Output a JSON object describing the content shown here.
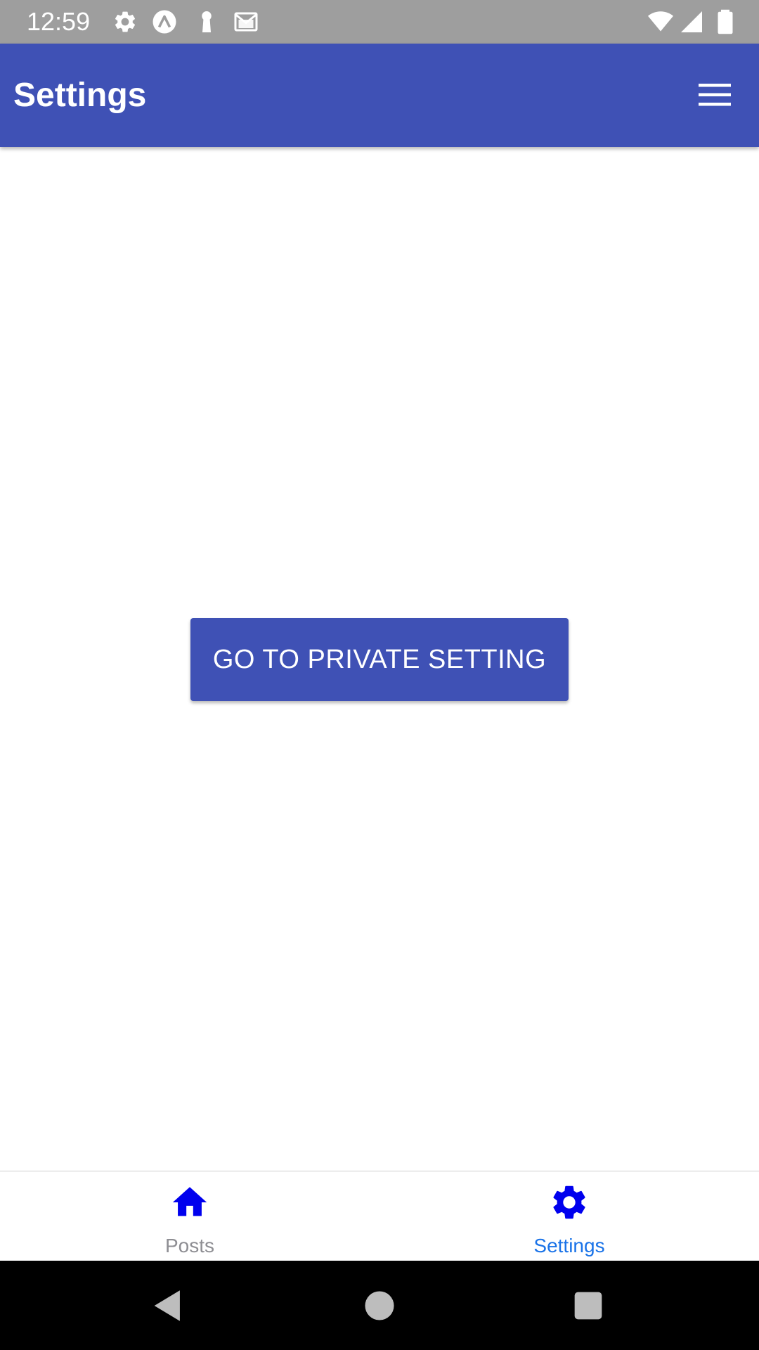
{
  "status_bar": {
    "time": "12:59",
    "icons_left": [
      "gear-icon",
      "app-a-icon",
      "keyhole-icon",
      "mail-icon"
    ],
    "icons_right": [
      "wifi-icon",
      "cell-signal-icon",
      "battery-icon"
    ]
  },
  "app_bar": {
    "title": "Settings",
    "menu_icon": "hamburger-menu-icon"
  },
  "main": {
    "button_label": "GO TO PRIVATE SETTING"
  },
  "tabs": [
    {
      "label": "Posts",
      "icon": "home-icon",
      "active": false
    },
    {
      "label": "Settings",
      "icon": "gear-icon",
      "active": true
    }
  ],
  "nav_bar": {
    "buttons": [
      "back-icon",
      "home-circle-icon",
      "recents-icon"
    ]
  },
  "colors": {
    "primary": "#3f51b5",
    "status_bar": "#9e9e9e",
    "tab_icon": "#0000ee",
    "tab_active_label": "#1a73e8",
    "tab_inactive_label": "#8e8e93"
  }
}
